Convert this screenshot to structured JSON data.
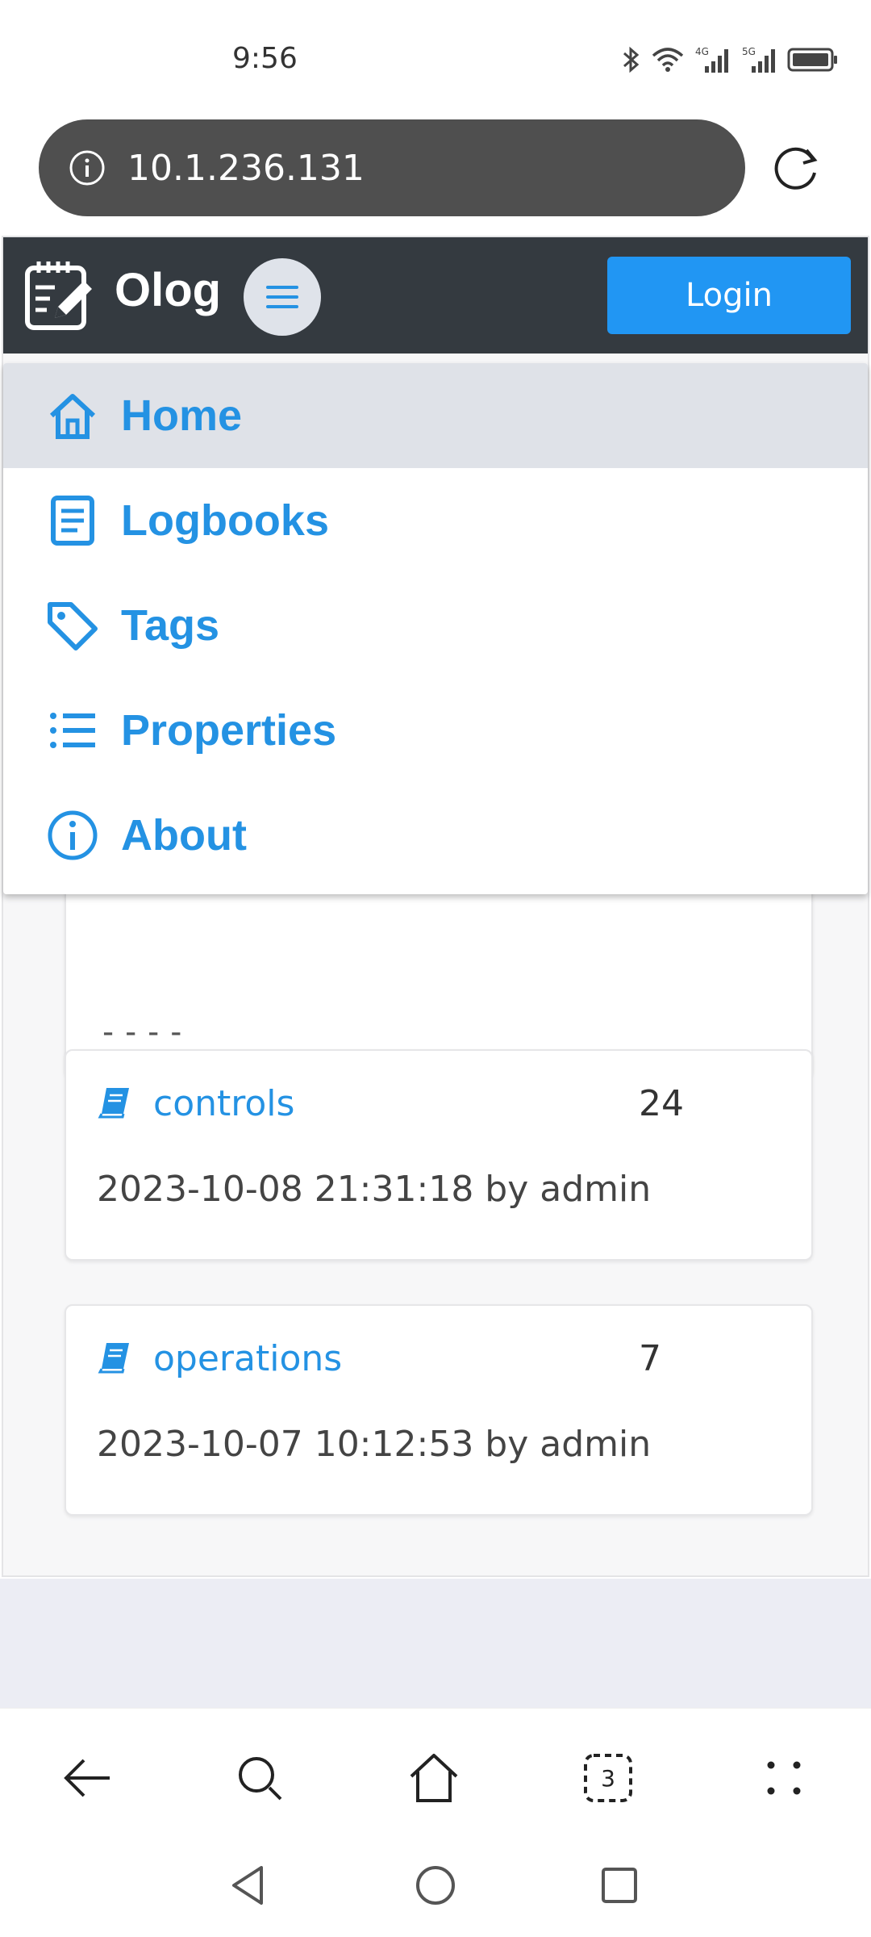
{
  "status_bar": {
    "time": "9:56",
    "network_labels": [
      "4G",
      "5G"
    ]
  },
  "browser": {
    "url": "10.1.236.131",
    "icons": [
      "info-icon",
      "reload-icon"
    ],
    "toolbar": {
      "tab_count": "3",
      "icons": [
        "back-arrow-icon",
        "search-icon",
        "home-icon",
        "tabs-icon",
        "more-icon"
      ]
    }
  },
  "app": {
    "title": "Olog",
    "login_label": "Login",
    "accent_color": "#2492e3",
    "header_color": "#343a40",
    "menu": [
      {
        "label": "Home",
        "icon": "home-icon",
        "active": true
      },
      {
        "label": "Logbooks",
        "icon": "logbook-icon",
        "active": false
      },
      {
        "label": "Tags",
        "icon": "tag-icon",
        "active": false
      },
      {
        "label": "Properties",
        "icon": "list-icon",
        "active": false
      },
      {
        "label": "About",
        "icon": "info-circle-icon",
        "active": false
      }
    ]
  },
  "cards": {
    "partial_card_text": "----",
    "logbooks": [
      {
        "name": "controls",
        "count": "24",
        "updated": "2023-10-08 21:31:18 by admin"
      },
      {
        "name": "operations",
        "count": "7",
        "updated": "2023-10-07 10:12:53 by admin"
      }
    ]
  }
}
